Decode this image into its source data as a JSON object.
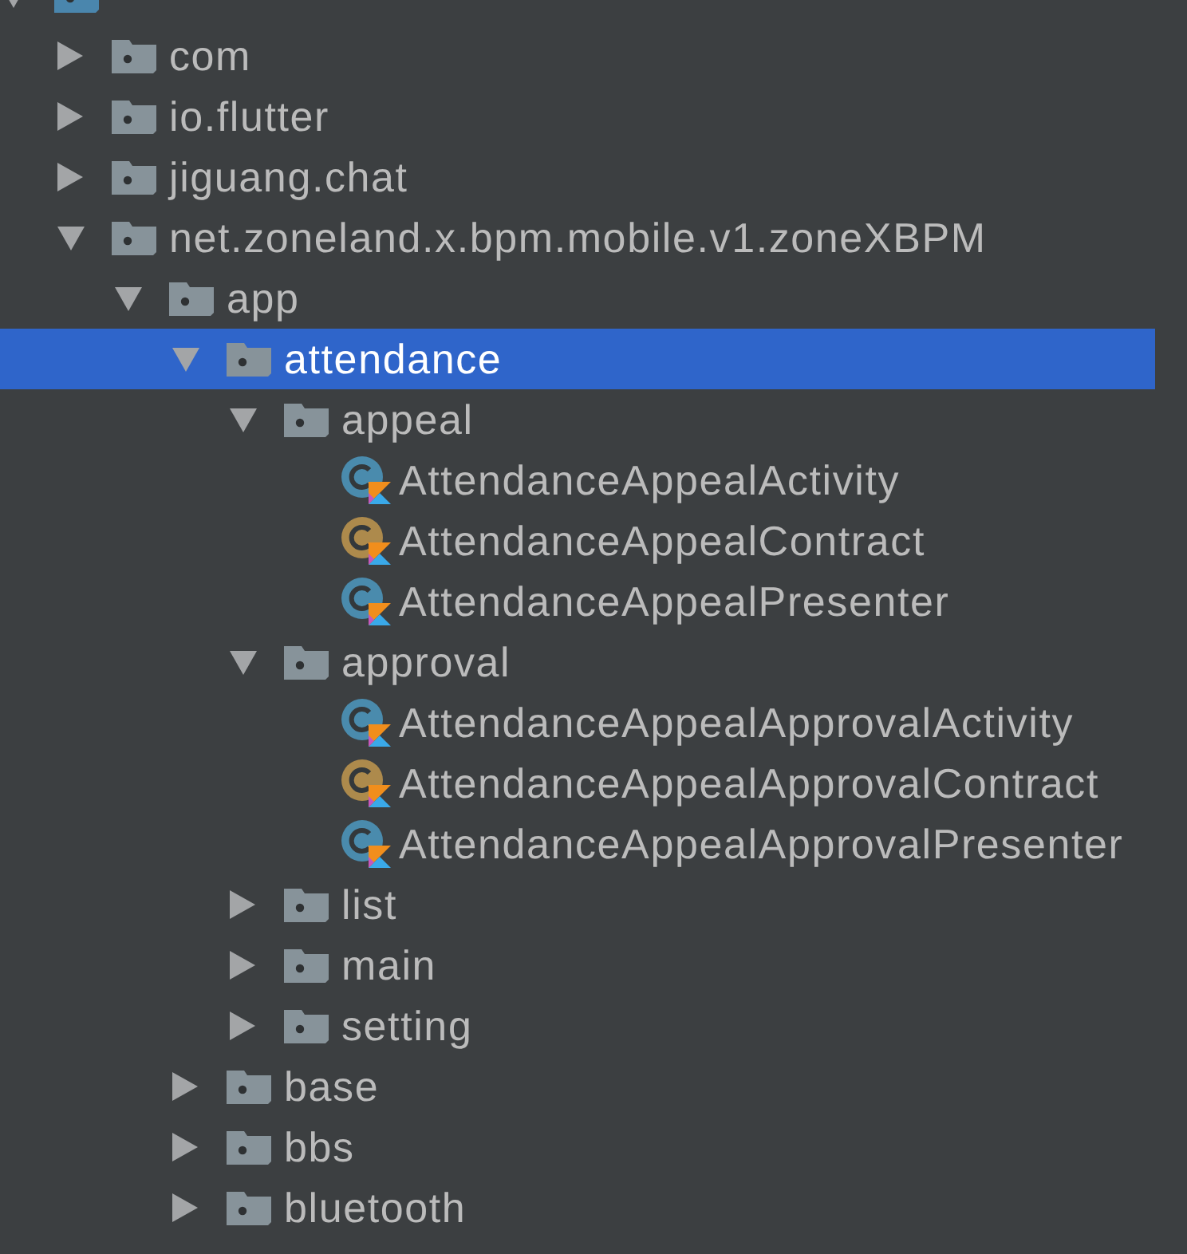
{
  "tree": [
    {
      "kind": "source-folder",
      "expanded": true,
      "selected": false,
      "children": [
        {
          "kind": "folder",
          "label": "com",
          "expanded": false,
          "selected": false
        },
        {
          "kind": "folder",
          "label": "io.flutter",
          "expanded": false,
          "selected": false
        },
        {
          "kind": "folder",
          "label": "jiguang.chat",
          "expanded": false,
          "selected": false
        },
        {
          "kind": "folder",
          "label": "net.zoneland.x.bpm.mobile.v1.zoneXBPM",
          "expanded": true,
          "selected": false,
          "children": [
            {
              "kind": "folder",
              "label": "app",
              "expanded": true,
              "selected": false,
              "children": [
                {
                  "kind": "folder",
                  "label": "attendance",
                  "expanded": true,
                  "selected": true,
                  "children": [
                    {
                      "kind": "folder",
                      "label": "appeal",
                      "expanded": true,
                      "selected": false,
                      "children": [
                        {
                          "kind": "file",
                          "label": "AttendanceAppealActivity",
                          "color": "#4a8bad",
                          "selected": false
                        },
                        {
                          "kind": "file",
                          "label": "AttendanceAppealContract",
                          "color": "#ad8a4c",
                          "selected": false
                        },
                        {
                          "kind": "file",
                          "label": "AttendanceAppealPresenter",
                          "color": "#4a8bad",
                          "selected": false
                        }
                      ]
                    },
                    {
                      "kind": "folder",
                      "label": "approval",
                      "expanded": true,
                      "selected": false,
                      "children": [
                        {
                          "kind": "file",
                          "label": "AttendanceAppealApprovalActivity",
                          "color": "#4a8bad",
                          "selected": false
                        },
                        {
                          "kind": "file",
                          "label": "AttendanceAppealApprovalContract",
                          "color": "#ad8a4c",
                          "selected": false
                        },
                        {
                          "kind": "file",
                          "label": "AttendanceAppealApprovalPresenter",
                          "color": "#4a8bad",
                          "selected": false
                        }
                      ]
                    },
                    {
                      "kind": "folder",
                      "label": "list",
                      "expanded": false,
                      "selected": false
                    },
                    {
                      "kind": "folder",
                      "label": "main",
                      "expanded": false,
                      "selected": false
                    },
                    {
                      "kind": "folder",
                      "label": "setting",
                      "expanded": false,
                      "selected": false
                    }
                  ]
                },
                {
                  "kind": "folder",
                  "label": "base",
                  "expanded": false,
                  "selected": false
                },
                {
                  "kind": "folder",
                  "label": "bbs",
                  "expanded": false,
                  "selected": false
                },
                {
                  "kind": "folder",
                  "label": "bluetooth",
                  "expanded": false,
                  "selected": false
                }
              ]
            }
          ]
        }
      ]
    }
  ]
}
